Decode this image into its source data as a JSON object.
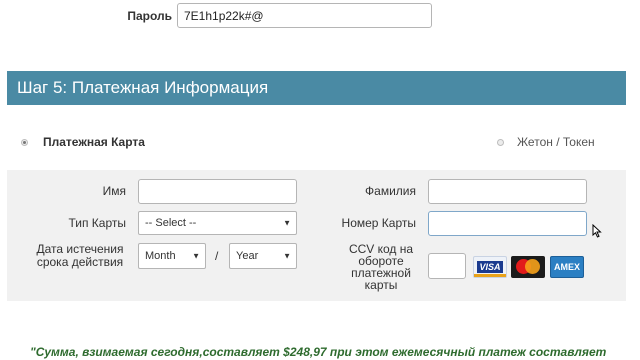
{
  "password": {
    "label": "Пароль",
    "value": "7E1h1p22k#@"
  },
  "step": {
    "title": "Шаг 5: Платежная Информация"
  },
  "payment_methods": {
    "card_label": "Платежная Карта",
    "token_label": "Жетон / Токен"
  },
  "form": {
    "first_name_label": "Имя",
    "last_name_label": "Фамилия",
    "card_type_label": "Тип Карты",
    "card_type_value": "-- Select --",
    "card_number_label": "Номер Карты",
    "expiry_label_line1": "Дата истечения",
    "expiry_label_line2": "срока действия",
    "month_value": "Month",
    "separator": "/",
    "year_value": "Year",
    "ccv_label_line1": "CCV код на",
    "ccv_label_line2": "обороте",
    "ccv_label_line3": "платежной",
    "ccv_label_line4": "карты"
  },
  "cards": {
    "visa": "VISA",
    "amex": "AMEX"
  },
  "colors": {
    "header_bg": "#4a8aa4",
    "summary_text": "#2e6b2e"
  },
  "summary": {
    "text": "\"Сумма, взимаемая сегодня,составляет $248,97 при этом ежемесячный платеж составляет"
  }
}
